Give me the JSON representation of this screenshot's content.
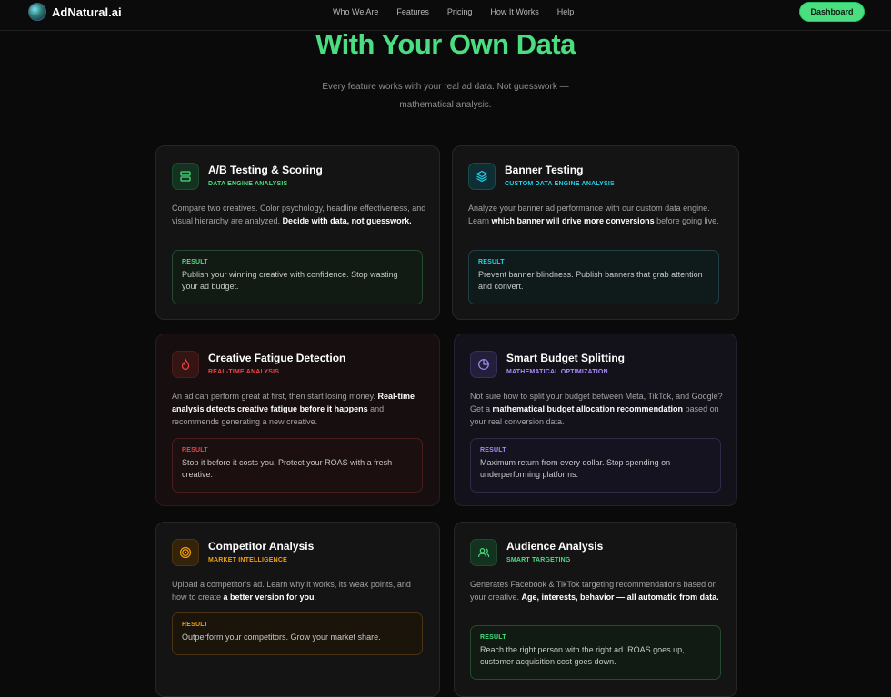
{
  "nav": {
    "brand": "AdNatural.ai",
    "links": [
      "Who We Are",
      "Features",
      "Pricing",
      "How It Works",
      "Help"
    ],
    "dashboard": "Dashboard"
  },
  "hero": {
    "title": "With Your Own Data",
    "subtitle": "Every feature works with your real ad data. Not guesswork — mathematical analysis."
  },
  "colors": {
    "accent_green": "#4ade80",
    "cyan": "#22d3ee",
    "red": "#ef4444",
    "purple": "#a78bfa",
    "orange": "#f59e0b"
  },
  "cards": [
    {
      "icon": "split-icon",
      "title": "A/B Testing & Scoring",
      "tag": "DATA ENGINE ANALYSIS",
      "desc": "Compare two creatives. Color psychology, headline effectiveness, and visual hierarchy are analyzed. ",
      "desc_bold": "Decide with data, not guesswork.",
      "desc_after": "",
      "result_label": "RESULT",
      "result_text": "Publish your winning creative with confidence. Stop wasting your ad budget."
    },
    {
      "icon": "layers-icon",
      "title": "Banner Testing",
      "tag": "CUSTOM DATA ENGINE ANALYSIS",
      "desc": "Analyze your banner ad performance with our custom data engine. Learn ",
      "desc_bold": "which banner will drive more conversions",
      "desc_after": " before going live.",
      "result_label": "RESULT",
      "result_text": "Prevent banner blindness. Publish banners that grab attention and convert."
    },
    {
      "icon": "flame-icon",
      "title": "Creative Fatigue Detection",
      "tag": "REAL-TIME ANALYSIS",
      "desc": "An ad can perform great at first, then start losing money. ",
      "desc_bold": "Real-time analysis detects creative fatigue before it happens",
      "desc_after": " and recommends generating a new creative.",
      "result_label": "RESULT",
      "result_text": "Stop it before it costs you. Protect your ROAS with a fresh creative."
    },
    {
      "icon": "pie-chart-icon",
      "title": "Smart Budget Splitting",
      "tag": "MATHEMATICAL OPTIMIZATION",
      "desc": "Not sure how to split your budget between Meta, TikTok, and Google? Get a ",
      "desc_bold": "mathematical budget allocation recommendation",
      "desc_after": " based on your real conversion data.",
      "result_label": "RESULT",
      "result_text": "Maximum return from every dollar. Stop spending on underperforming platforms."
    },
    {
      "icon": "target-icon",
      "title": "Competitor Analysis",
      "tag": "MARKET INTELLIGENCE",
      "desc": "Upload a competitor's ad. Learn why it works, its weak points, and how to create ",
      "desc_bold": "a better version for you",
      "desc_after": ".",
      "result_label": "RESULT",
      "result_text": "Outperform your competitors. Grow your market share."
    },
    {
      "icon": "users-icon",
      "title": "Audience Analysis",
      "tag": "SMART TARGETING",
      "desc": "Generates Facebook & TikTok targeting recommendations based on your creative. ",
      "desc_bold": "Age, interests, behavior — all automatic from data.",
      "desc_after": "",
      "result_label": "RESULT",
      "result_text": "Reach the right person with the right ad. ROAS goes up, customer acquisition cost goes down."
    }
  ]
}
